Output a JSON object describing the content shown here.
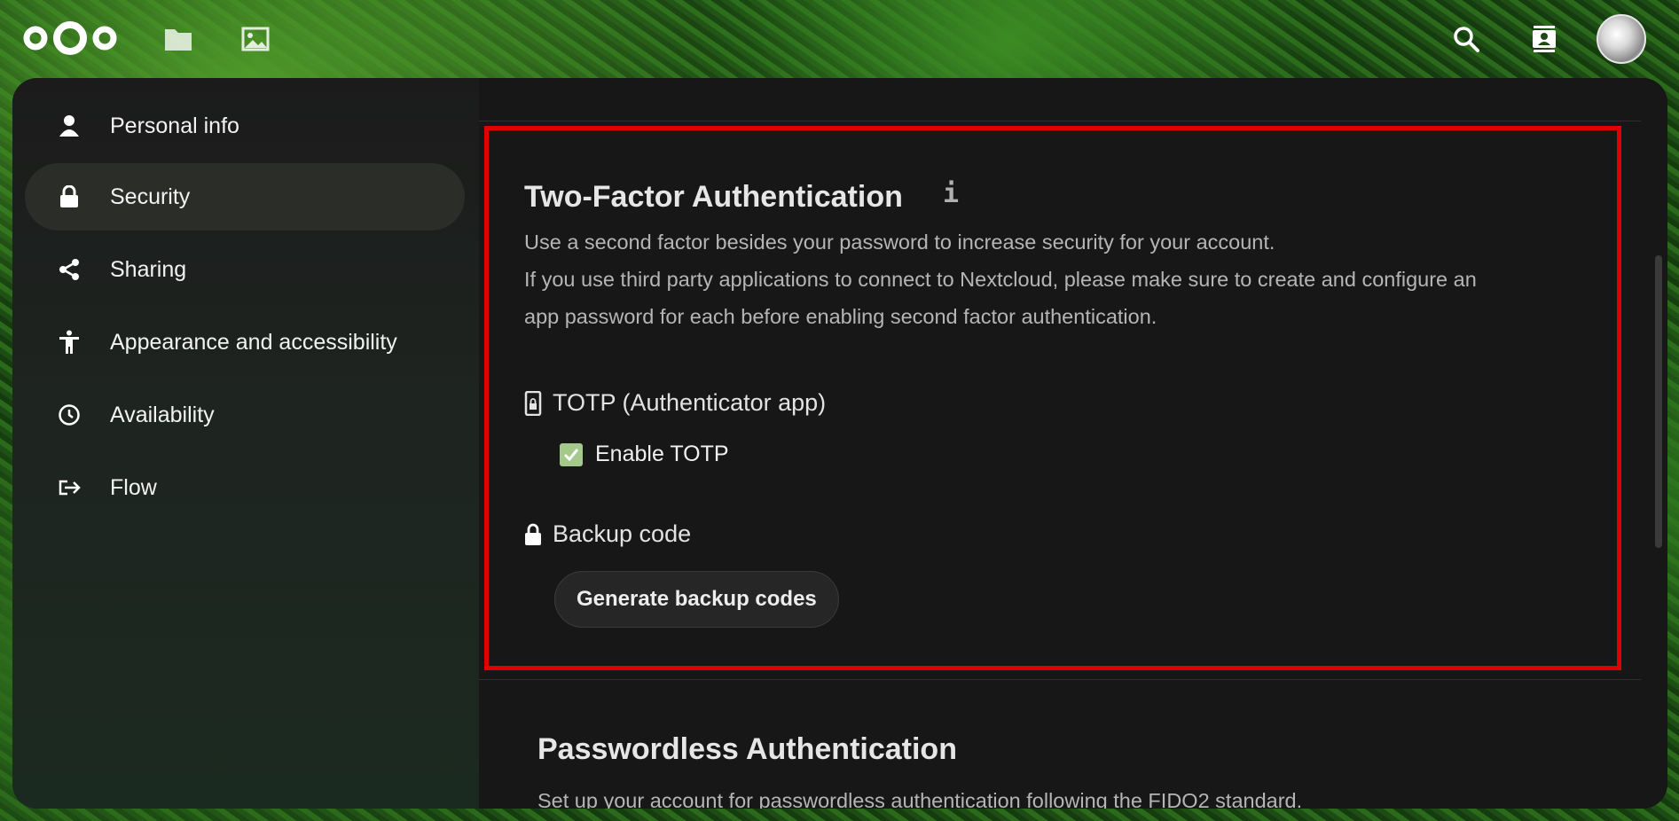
{
  "header": {
    "logo_icon": "nextcloud-logo",
    "apps": [
      {
        "name": "files",
        "icon": "folder-icon"
      },
      {
        "name": "photos",
        "icon": "image-icon"
      }
    ],
    "search_icon": "search-icon",
    "contacts_icon": "contacts-icon",
    "avatar_icon": "user-avatar"
  },
  "sidebar": {
    "items": [
      {
        "label": "Personal info",
        "icon": "person-icon"
      },
      {
        "label": "Security",
        "icon": "lock-icon",
        "active": true
      },
      {
        "label": "Sharing",
        "icon": "share-icon"
      },
      {
        "label": "Appearance and accessibility",
        "icon": "accessibility-icon"
      },
      {
        "label": "Availability",
        "icon": "clock-icon"
      },
      {
        "label": "Flow",
        "icon": "flow-icon"
      }
    ]
  },
  "twofactor": {
    "title": "Two-Factor Authentication",
    "info_icon": "info-icon",
    "description_line1": "Use a second factor besides your password to increase security for your account.",
    "description_line2": "If you use third party applications to connect to Nextcloud, please make sure to create and configure an",
    "description_line3": "app password for each before enabling second factor authentication.",
    "totp": {
      "title": "TOTP (Authenticator app)",
      "icon": "phone-lock-icon",
      "checkbox_label": "Enable TOTP",
      "checked": true
    },
    "backup": {
      "title": "Backup code",
      "icon": "lock-icon",
      "button_label": "Generate backup codes"
    }
  },
  "passwordless": {
    "title": "Passwordless Authentication",
    "description": "Set up your account for passwordless authentication following the FIDO2 standard."
  },
  "colors": {
    "accent_checkbox": "#a4c98a",
    "highlight_border": "#e00000",
    "panel_bg": "#171717"
  }
}
